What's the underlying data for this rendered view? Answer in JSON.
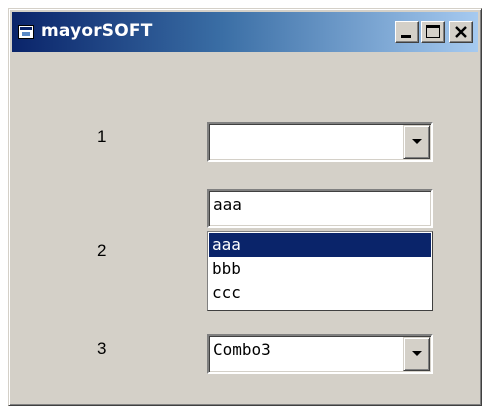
{
  "window": {
    "title": "mayorSOFT",
    "icon": "app-window-icon",
    "controls": [
      "minimize-icon",
      "maximize-icon",
      "close-icon"
    ]
  },
  "rows": {
    "label1": "1",
    "label2": "2",
    "label3": "3"
  },
  "combo1": {
    "value": ""
  },
  "combo2": {
    "value": "aaa",
    "items": [
      "aaa",
      "bbb",
      "ccc"
    ],
    "selected_index": 0
  },
  "combo3": {
    "value": "Combo3"
  },
  "colors": {
    "face": "#d4d0c8",
    "titlebar_start": "#0a246a",
    "titlebar_end": "#a6caf0",
    "selection": "#0a246a"
  }
}
